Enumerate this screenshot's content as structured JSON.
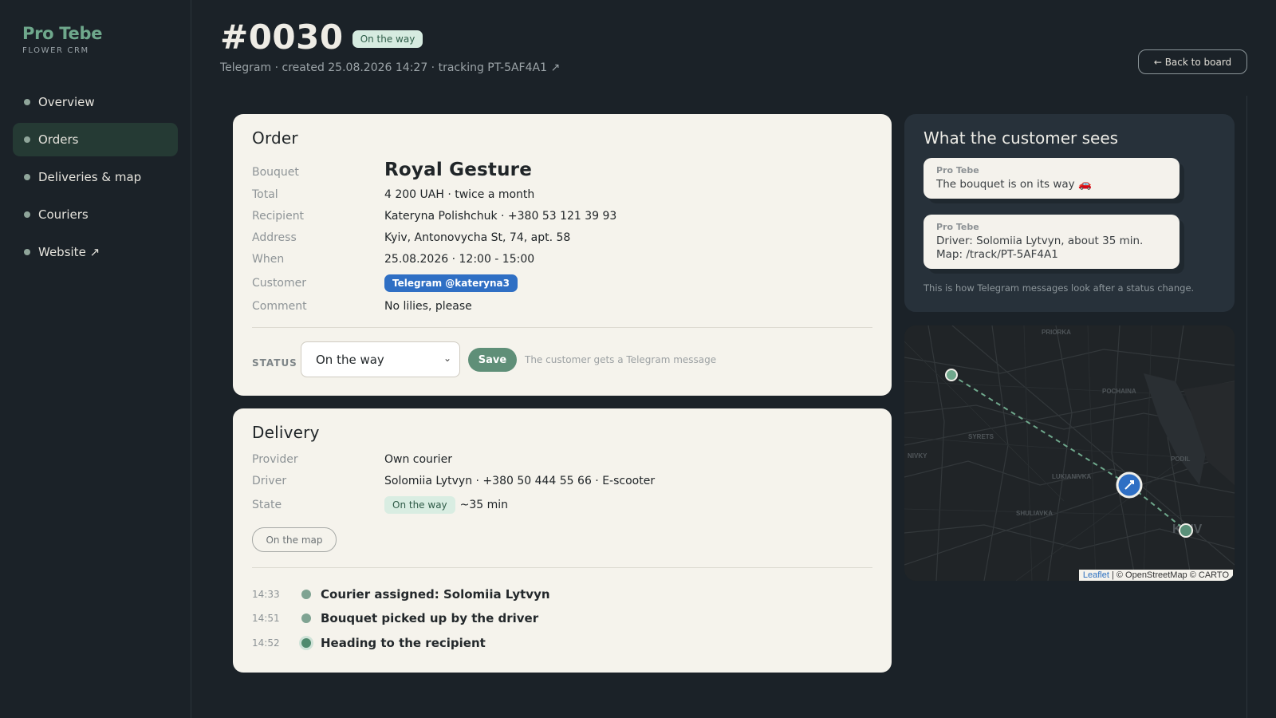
{
  "brand": {
    "name": "Pro Tebe",
    "subtitle": "FLOWER CRM"
  },
  "nav": {
    "items": [
      {
        "label": "Overview",
        "active": false
      },
      {
        "label": "Orders",
        "active": true
      },
      {
        "label": "Deliveries & map",
        "active": false
      },
      {
        "label": "Couriers",
        "active": false
      },
      {
        "label": "Website ↗",
        "active": false
      }
    ]
  },
  "header": {
    "order_number": "#0030",
    "status_badge": "On the way",
    "meta": "Telegram · created 25.08.2026 14:27 · tracking PT-5AF4A1 ↗",
    "back_button": "← Back to board"
  },
  "order": {
    "title": "Order",
    "rows": [
      {
        "label": "Bouquet",
        "value": "Royal Gesture"
      },
      {
        "label": "Total",
        "value": "4 200 UAH · twice a month"
      },
      {
        "label": "Recipient",
        "value": "Kateryna Polishchuk · +380 53 121 39 93"
      },
      {
        "label": "Address",
        "value": "Kyiv, Antonovycha St, 74, apt. 58"
      },
      {
        "label": "When",
        "value": "25.08.2026 · 12:00 - 15:00"
      },
      {
        "label": "Customer",
        "value": "Telegram @kateryna3"
      },
      {
        "label": "Comment",
        "value": "No lilies, please"
      }
    ],
    "status_label": "STATUS",
    "status_value": "On the way",
    "save_button": "Save",
    "status_hint": "The customer gets a Telegram message"
  },
  "delivery": {
    "title": "Delivery",
    "rows": [
      {
        "label": "Provider",
        "value": "Own courier"
      },
      {
        "label": "Driver",
        "value": "Solomiia Lytvyn · +380 50 444 55 66 · E-scooter"
      },
      {
        "label": "State",
        "value": "On the way",
        "eta": "~35 min"
      }
    ],
    "map_button": "On the map",
    "timeline": [
      {
        "time": "14:33",
        "text": "Courier assigned: Solomiia Lytvyn"
      },
      {
        "time": "14:51",
        "text": "Bouquet picked up by the driver"
      },
      {
        "time": "14:52",
        "text": "Heading to the recipient"
      }
    ]
  },
  "customer_view": {
    "title": "What the customer sees",
    "messages": [
      {
        "from": "Pro Tebe",
        "text": "The bouquet is on its way 🚗"
      },
      {
        "from": "Pro Tebe",
        "text": "Driver: Solomiia Lytvyn, about 35 min. Map: /track/PT-5AF4A1"
      }
    ],
    "note": "This is how Telegram messages look after a status change."
  },
  "map": {
    "labels": [
      "PRIORKA",
      "POCHAINA",
      "SYRETS",
      "NIVKY",
      "LUKIANIVKA",
      "PODIL",
      "SHULIAVKA",
      "KYIV"
    ],
    "attribution_link": "Leaflet",
    "attribution_rest": " | © OpenStreetMap © CARTO"
  },
  "colors": {
    "accent": "#5f8f78",
    "background": "#1b2228",
    "card": "#f5f3ec",
    "telegram": "#2f6fc4"
  }
}
